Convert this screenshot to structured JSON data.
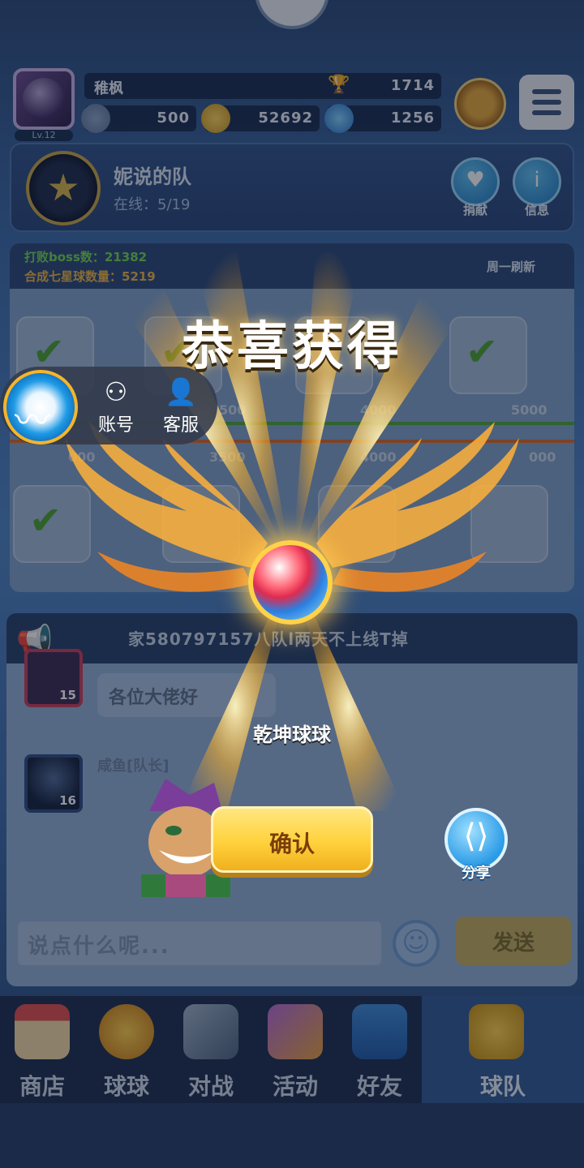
{
  "player": {
    "name": "稚枫",
    "level": "Lv.12",
    "trophies": "1714",
    "resources": {
      "stamina": "500",
      "coins": "52692",
      "gems": "1256"
    }
  },
  "team": {
    "name": "妮说的队",
    "online": "在线：5/19",
    "donate_label": "捐献",
    "info_label": "信息"
  },
  "stats": {
    "boss_defeated": "打败boss数：21382",
    "seven_star_balls": "合成七星球数量：5219",
    "refresh_label": "周一刷新",
    "top_milestones": [
      "500",
      "4000",
      "5000"
    ],
    "bottom_milestones": [
      "000",
      "3500",
      "4000",
      "000"
    ]
  },
  "chat": {
    "marquee": "家580797157八队l两天不上线T掉",
    "messages": [
      {
        "level": "15",
        "text": "各位大佬好"
      },
      {
        "level": "16",
        "sender": "咸鱼[队长]"
      }
    ],
    "input_placeholder": "说点什么呢...",
    "send_label": "发送"
  },
  "nav": [
    {
      "label": "商店",
      "icon": "shop-icon"
    },
    {
      "label": "球球",
      "icon": "ball-icon"
    },
    {
      "label": "对战",
      "icon": "swords-icon"
    },
    {
      "label": "活动",
      "icon": "party-icon"
    },
    {
      "label": "好友",
      "icon": "friends-icon"
    },
    {
      "label": "球队",
      "icon": "whistle-icon"
    }
  ],
  "reward": {
    "title": "恭喜获得",
    "item_name": "乾坤球球",
    "confirm_label": "确认",
    "share_label": "分享"
  },
  "float_menu": {
    "account_label": "账号",
    "service_label": "客服"
  },
  "colors": {
    "accent_gold": "#ffd23c",
    "team_green": "#6fd84f",
    "share_blue": "#2b9be6"
  }
}
